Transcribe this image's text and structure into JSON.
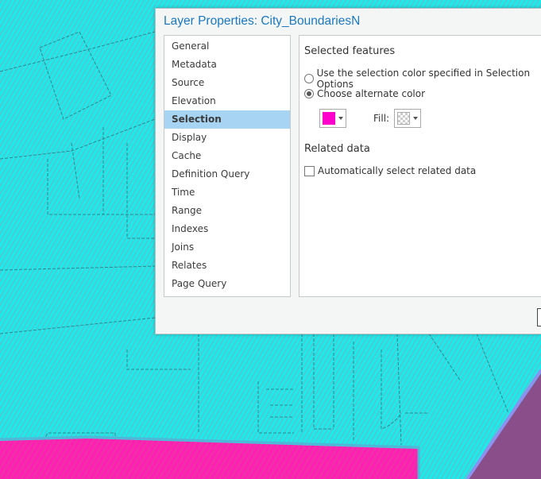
{
  "dialog": {
    "title": "Layer Properties: City_BoundariesN"
  },
  "nav": {
    "items": [
      "General",
      "Metadata",
      "Source",
      "Elevation",
      "Selection",
      "Display",
      "Cache",
      "Definition Query",
      "Time",
      "Range",
      "Indexes",
      "Joins",
      "Relates",
      "Page Query"
    ],
    "selected": "Selection"
  },
  "selection": {
    "heading": "Selected features",
    "option_default": "Use the selection color specified in Selection Options",
    "option_alternate": "Choose alternate color",
    "selected_option": "alternate",
    "color": "#ff00cc",
    "fill_label": "Fill:",
    "related_heading": "Related data",
    "auto_select_label": "Automatically select related data",
    "auto_select_checked": false
  },
  "colors": {
    "map_fill": "#19ecec",
    "selection_fill": "#ff1fb4",
    "other_poly": "#8a4f8a",
    "accent": "#1a78c2"
  }
}
